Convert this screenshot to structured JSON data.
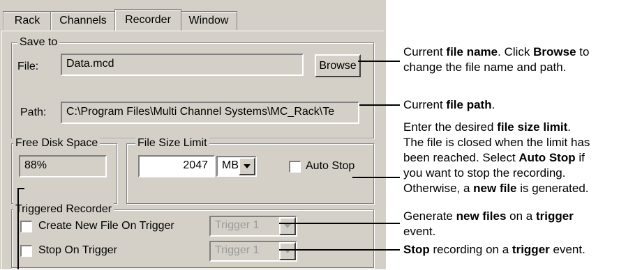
{
  "tabs": [
    "Rack",
    "Channels",
    "Recorder",
    "Window"
  ],
  "save_to": {
    "legend": "Save to",
    "file_label": "File:",
    "file_value": "Data.mcd",
    "browse_label": "Browse",
    "path_label": "Path:",
    "path_value": "C:\\Program Files\\Multi Channel Systems\\MC_Rack\\Te"
  },
  "free_disk": {
    "legend": "Free Disk Space",
    "value": "88%"
  },
  "file_size": {
    "legend": "File Size Limit",
    "value": "2047",
    "unit": "MB",
    "auto_stop_label": "Auto Stop"
  },
  "triggered": {
    "legend": "Triggered Recorder",
    "create_label": "Create New File On Trigger",
    "create_trigger": "Trigger 1",
    "stop_label": "Stop On Trigger",
    "stop_trigger": "Trigger 1"
  },
  "callouts": {
    "c1": [
      [
        {
          "t": "Current "
        },
        {
          "t": "file name",
          "b": true
        },
        {
          "t": ". Click "
        },
        {
          "t": "Browse",
          "b": true
        },
        {
          "t": " to"
        }
      ],
      [
        {
          "t": "change the file name and path."
        }
      ]
    ],
    "c2": [
      [
        {
          "t": "Current "
        },
        {
          "t": "file path",
          "b": true
        },
        {
          "t": "."
        }
      ]
    ],
    "c3": [
      [
        {
          "t": "Enter the desired "
        },
        {
          "t": "file size limit",
          "b": true
        },
        {
          "t": "."
        }
      ],
      [
        {
          "t": "The file is closed when the limit has"
        }
      ],
      [
        {
          "t": "been reached. Select "
        },
        {
          "t": "Auto Stop",
          "b": true
        },
        {
          "t": " if"
        }
      ],
      [
        {
          "t": "you want to stop the recording."
        }
      ],
      [
        {
          "t": "Otherwise, a "
        },
        {
          "t": "new file",
          "b": true
        },
        {
          "t": " is generated."
        }
      ]
    ],
    "c4": [
      [
        {
          "t": "Generate "
        },
        {
          "t": "new files",
          "b": true
        },
        {
          "t": " on a "
        },
        {
          "t": "trigger",
          "b": true
        }
      ],
      [
        {
          "t": "event."
        }
      ]
    ],
    "c5": [
      [
        {
          "t": "Stop",
          "b": true
        },
        {
          "t": " recording on a "
        },
        {
          "t": "trigger",
          "b": true
        },
        {
          "t": " event."
        }
      ]
    ]
  }
}
